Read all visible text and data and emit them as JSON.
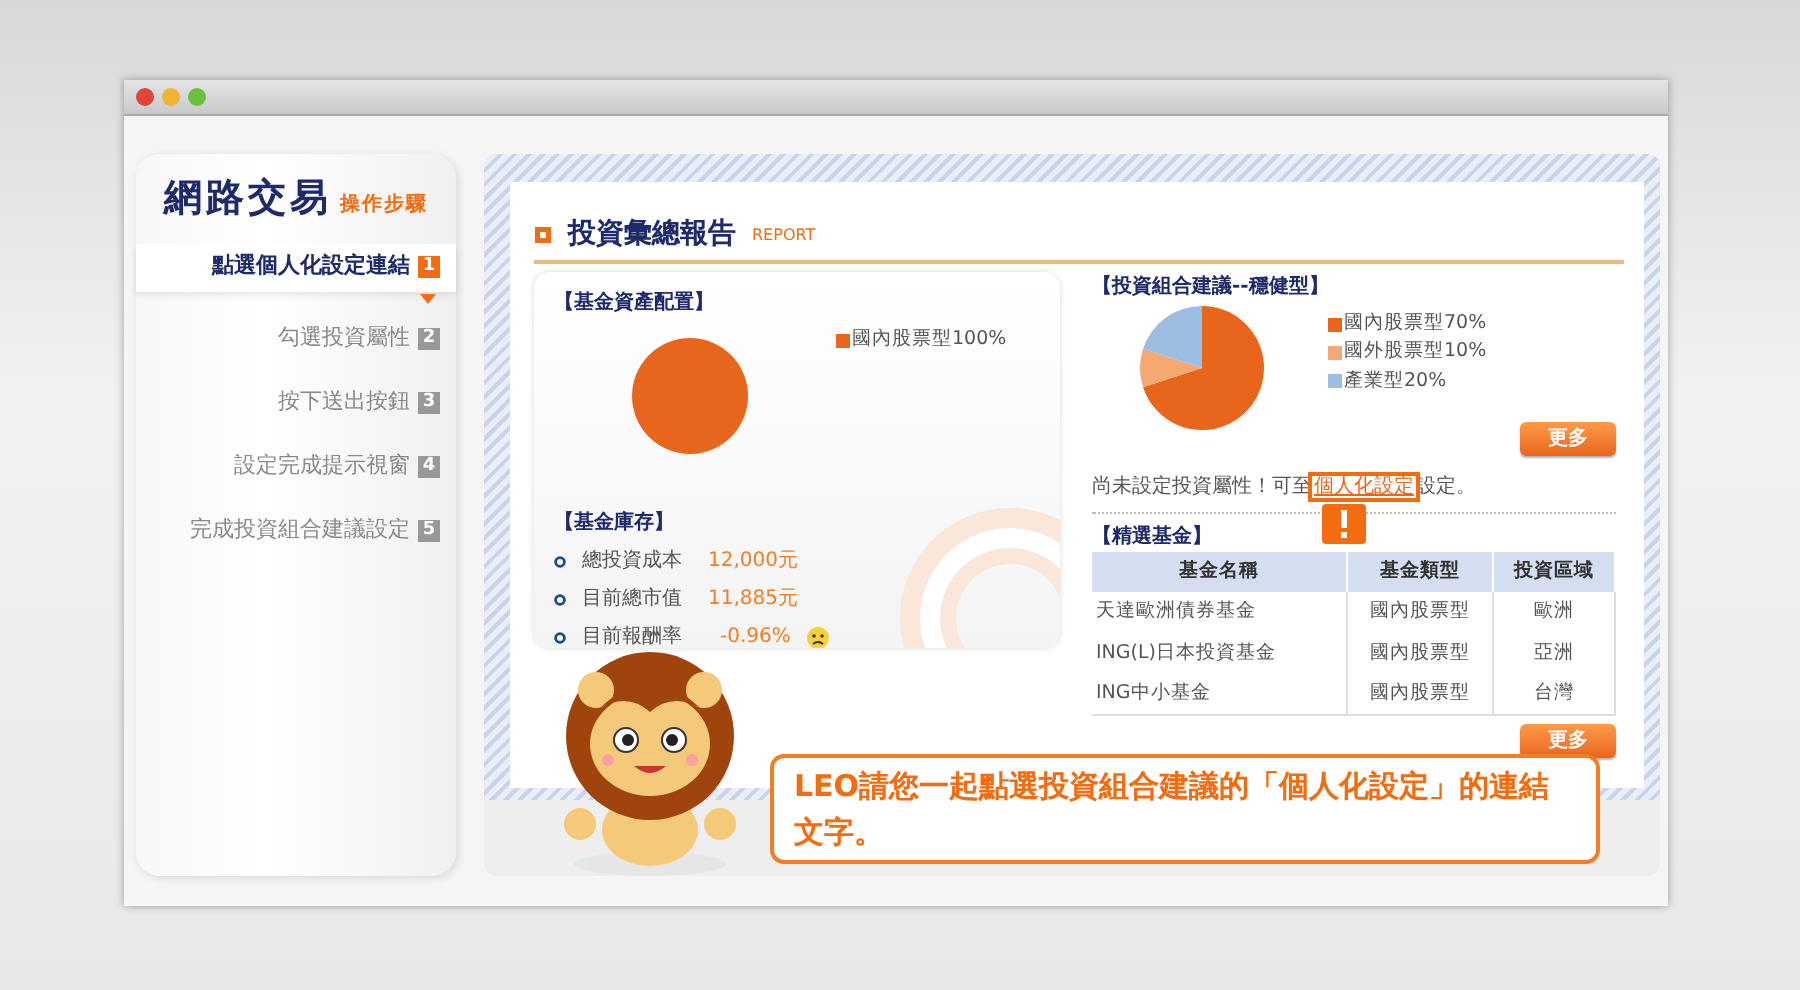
{
  "sidebar": {
    "title": "網路交易",
    "subtitle": "操作步驟",
    "steps": [
      {
        "label": "點選個人化設定連結",
        "number": "1",
        "selected": true
      },
      {
        "label": "勾選投資屬性",
        "number": "2",
        "selected": false
      },
      {
        "label": "按下送出按鈕",
        "number": "3",
        "selected": false
      },
      {
        "label": "設定完成提示視窗",
        "number": "4",
        "selected": false
      },
      {
        "label": "完成投資組合建議設定",
        "number": "5",
        "selected": false
      }
    ]
  },
  "report": {
    "title": "投資彙總報告",
    "subtitle": "REPORT"
  },
  "allocation": {
    "heading": "【基金資產配置】",
    "chart_data": {
      "type": "pie",
      "categories": [
        "國內股票型100%"
      ],
      "values": [
        100
      ],
      "colors": [
        "#e8661c"
      ],
      "legend": "right"
    }
  },
  "holdings": {
    "heading": "【基金庫存】",
    "items": [
      {
        "label": "總投資成本",
        "value": "12,000元",
        "kind": "plain"
      },
      {
        "label": "目前總市值",
        "value": "11,885元",
        "kind": "plain"
      },
      {
        "label": "目前報酬率",
        "value": "-0.96%",
        "kind": "sad"
      }
    ]
  },
  "suggestion": {
    "heading": "【投資組合建議--穩健型】",
    "chart_data": {
      "type": "pie",
      "categories": [
        "國內股票型70%",
        "國外股票型10%",
        "產業型20%"
      ],
      "values": [
        70,
        10,
        20
      ],
      "colors": [
        "#e8661c",
        "#f4a872",
        "#9dbde3"
      ],
      "legend": "right"
    },
    "more_button": "更多",
    "note": {
      "before": "尚未設定投資屬性！可至",
      "link": "個人化設定",
      "after": "設定。",
      "highlighted": true
    }
  },
  "funds": {
    "heading": "【精選基金】",
    "columns": [
      "基金名稱",
      "基金類型",
      "投資區域"
    ],
    "rows": [
      [
        "天達歐洲債券基金",
        "國內股票型",
        "歐洲"
      ],
      [
        "ING(L)日本投資基金",
        "國內股票型",
        "亞洲"
      ],
      [
        "ING中小基金",
        "國內股票型",
        "台灣"
      ]
    ],
    "more_button": "更多"
  },
  "tip": "LEO請您一起點選投資組合建議的「個人化設定」的連結文字。"
}
